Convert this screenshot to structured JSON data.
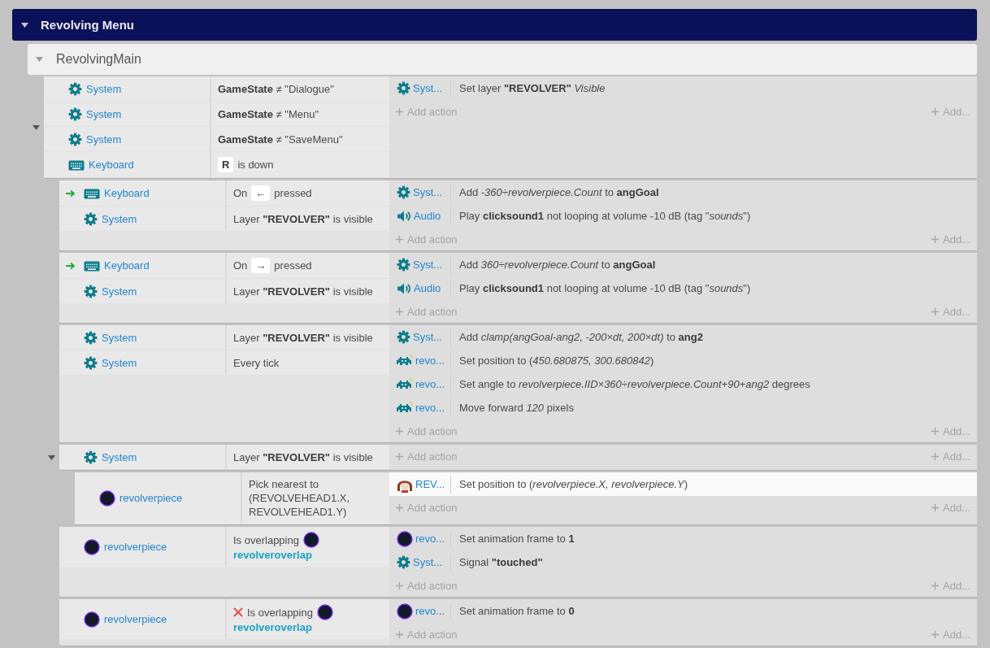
{
  "group": {
    "title": "Revolving Menu",
    "expanded": true
  },
  "subgroup": {
    "title": "RevolvingMain",
    "expanded": true
  },
  "events": [
    {
      "expanded": true,
      "conditions": [
        {
          "kind": "system",
          "object": "System",
          "trigger": false,
          "inverted": false,
          "parts": [
            {
              "kind": "text",
              "text": "**GameState** ≠ \"Dialogue\""
            }
          ]
        },
        {
          "kind": "system",
          "object": "System",
          "trigger": false,
          "inverted": false,
          "parts": [
            {
              "kind": "text",
              "text": "**GameState** ≠ \"Menu\""
            }
          ]
        },
        {
          "kind": "system",
          "object": "System",
          "trigger": false,
          "inverted": false,
          "parts": [
            {
              "kind": "text",
              "text": "**GameState** ≠ \"SaveMenu\""
            }
          ]
        },
        {
          "kind": "keyboard",
          "object": "Keyboard",
          "trigger": false,
          "inverted": false,
          "parts": [
            {
              "kind": "key",
              "text": "R"
            },
            {
              "kind": "text",
              "text": "is down"
            }
          ]
        }
      ],
      "actions": [
        {
          "kind": "system",
          "object": "Syst...",
          "text": "Set layer **\"REVOLVER\"** *Visible*",
          "selected": false
        }
      ],
      "add_action": "Add action",
      "add_more": "Add...",
      "children": [
        {
          "conditions": [
            {
              "kind": "keyboard",
              "object": "Keyboard",
              "trigger": true,
              "inverted": false,
              "parts": [
                {
                  "kind": "text",
                  "text": "On"
                },
                {
                  "kind": "key",
                  "text": "←"
                },
                {
                  "kind": "text",
                  "text": "pressed"
                }
              ]
            },
            {
              "kind": "system",
              "object": "System",
              "trigger": false,
              "inverted": false,
              "parts": [
                {
                  "kind": "text",
                  "text": "Layer **\"REVOLVER\"** is visible"
                }
              ]
            }
          ],
          "actions": [
            {
              "kind": "system",
              "object": "Syst...",
              "text": "Add *-360÷revolverpiece.Count* to **angGoal**",
              "selected": false
            },
            {
              "kind": "audio",
              "object": "Audio",
              "text": "Play **clicksound1** not looping at volume -10 dB (tag \"*sounds*\")",
              "selected": false
            }
          ],
          "add_action": "Add action",
          "add_more": "Add..."
        },
        {
          "conditions": [
            {
              "kind": "keyboard",
              "object": "Keyboard",
              "trigger": true,
              "inverted": false,
              "parts": [
                {
                  "kind": "text",
                  "text": "On"
                },
                {
                  "kind": "key",
                  "text": "→"
                },
                {
                  "kind": "text",
                  "text": "pressed"
                }
              ]
            },
            {
              "kind": "system",
              "object": "System",
              "trigger": false,
              "inverted": false,
              "parts": [
                {
                  "kind": "text",
                  "text": "Layer **\"REVOLVER\"** is visible"
                }
              ]
            }
          ],
          "actions": [
            {
              "kind": "system",
              "object": "Syst...",
              "text": "Add *360÷revolverpiece.Count* to **angGoal**",
              "selected": false
            },
            {
              "kind": "audio",
              "object": "Audio",
              "text": "Play **clicksound1** not looping at volume -10 dB (tag \"*sounds*\")",
              "selected": false
            }
          ],
          "add_action": "Add action",
          "add_more": "Add..."
        },
        {
          "conditions": [
            {
              "kind": "system",
              "object": "System",
              "trigger": false,
              "inverted": false,
              "parts": [
                {
                  "kind": "text",
                  "text": "Layer **\"REVOLVER\"** is visible"
                }
              ]
            },
            {
              "kind": "system",
              "object": "System",
              "trigger": false,
              "inverted": false,
              "parts": [
                {
                  "kind": "text",
                  "text": "Every tick"
                }
              ]
            }
          ],
          "actions": [
            {
              "kind": "system",
              "object": "Syst...",
              "text": "Add *clamp(angGoal-ang2, -200×dt, 200×dt)* to **ang2**",
              "selected": false
            },
            {
              "kind": "sprite",
              "object": "revo...",
              "text": "Set position to (*450.680875, 300.680842*)",
              "selected": false
            },
            {
              "kind": "sprite",
              "object": "revo...",
              "text": "Set angle to *revolverpiece.IID×360÷revolverpiece.Count+90+ang2* degrees",
              "selected": false
            },
            {
              "kind": "sprite",
              "object": "revo...",
              "text": "Move forward *120* pixels",
              "selected": false
            }
          ],
          "add_action": "Add action",
          "add_more": "Add..."
        },
        {
          "expanded": true,
          "conditions": [
            {
              "kind": "system",
              "object": "System",
              "trigger": false,
              "inverted": false,
              "parts": [
                {
                  "kind": "text",
                  "text": "Layer **\"REVOLVER\"** is visible"
                }
              ]
            }
          ],
          "add_action": "Add action",
          "add_more": "Add...",
          "children": [
            {
              "conditions": [
                {
                  "kind": "circle",
                  "object": "revolverpiece",
                  "trigger": false,
                  "inverted": false,
                  "parts": [
                    {
                      "kind": "text",
                      "text": "Pick nearest to (REVOLVEHEAD1.X, REVOLVEHEAD1.Y)"
                    }
                  ]
                }
              ],
              "actions": [
                {
                  "kind": "character",
                  "object": "REV...",
                  "text": "Set position to (*revolverpiece.X, revolverpiece.Y*)",
                  "selected": true
                }
              ],
              "add_action": "Add action",
              "add_more": "Add..."
            }
          ]
        },
        {
          "conditions": [
            {
              "kind": "circle",
              "object": "revolverpiece",
              "trigger": false,
              "inverted": false,
              "parts": [
                {
                  "kind": "text",
                  "text": "Is overlapping"
                },
                {
                  "kind": "object",
                  "text": "revolveroverlap"
                }
              ]
            }
          ],
          "actions": [
            {
              "kind": "circle",
              "object": "revo...",
              "text": "Set animation frame to **1**",
              "selected": false
            },
            {
              "kind": "system",
              "object": "Syst...",
              "text": "Signal **\"touched\"**",
              "selected": false
            }
          ],
          "add_action": "Add action",
          "add_more": "Add..."
        },
        {
          "conditions": [
            {
              "kind": "circle",
              "object": "revolverpiece",
              "trigger": false,
              "inverted": true,
              "parts": [
                {
                  "kind": "text",
                  "text": "Is overlapping"
                },
                {
                  "kind": "object",
                  "text": "revolveroverlap"
                }
              ]
            }
          ],
          "actions": [
            {
              "kind": "circle",
              "object": "revo...",
              "text": "Set animation frame to **0**",
              "selected": false
            }
          ],
          "add_action": "Add action",
          "add_more": "Add..."
        }
      ]
    }
  ]
}
